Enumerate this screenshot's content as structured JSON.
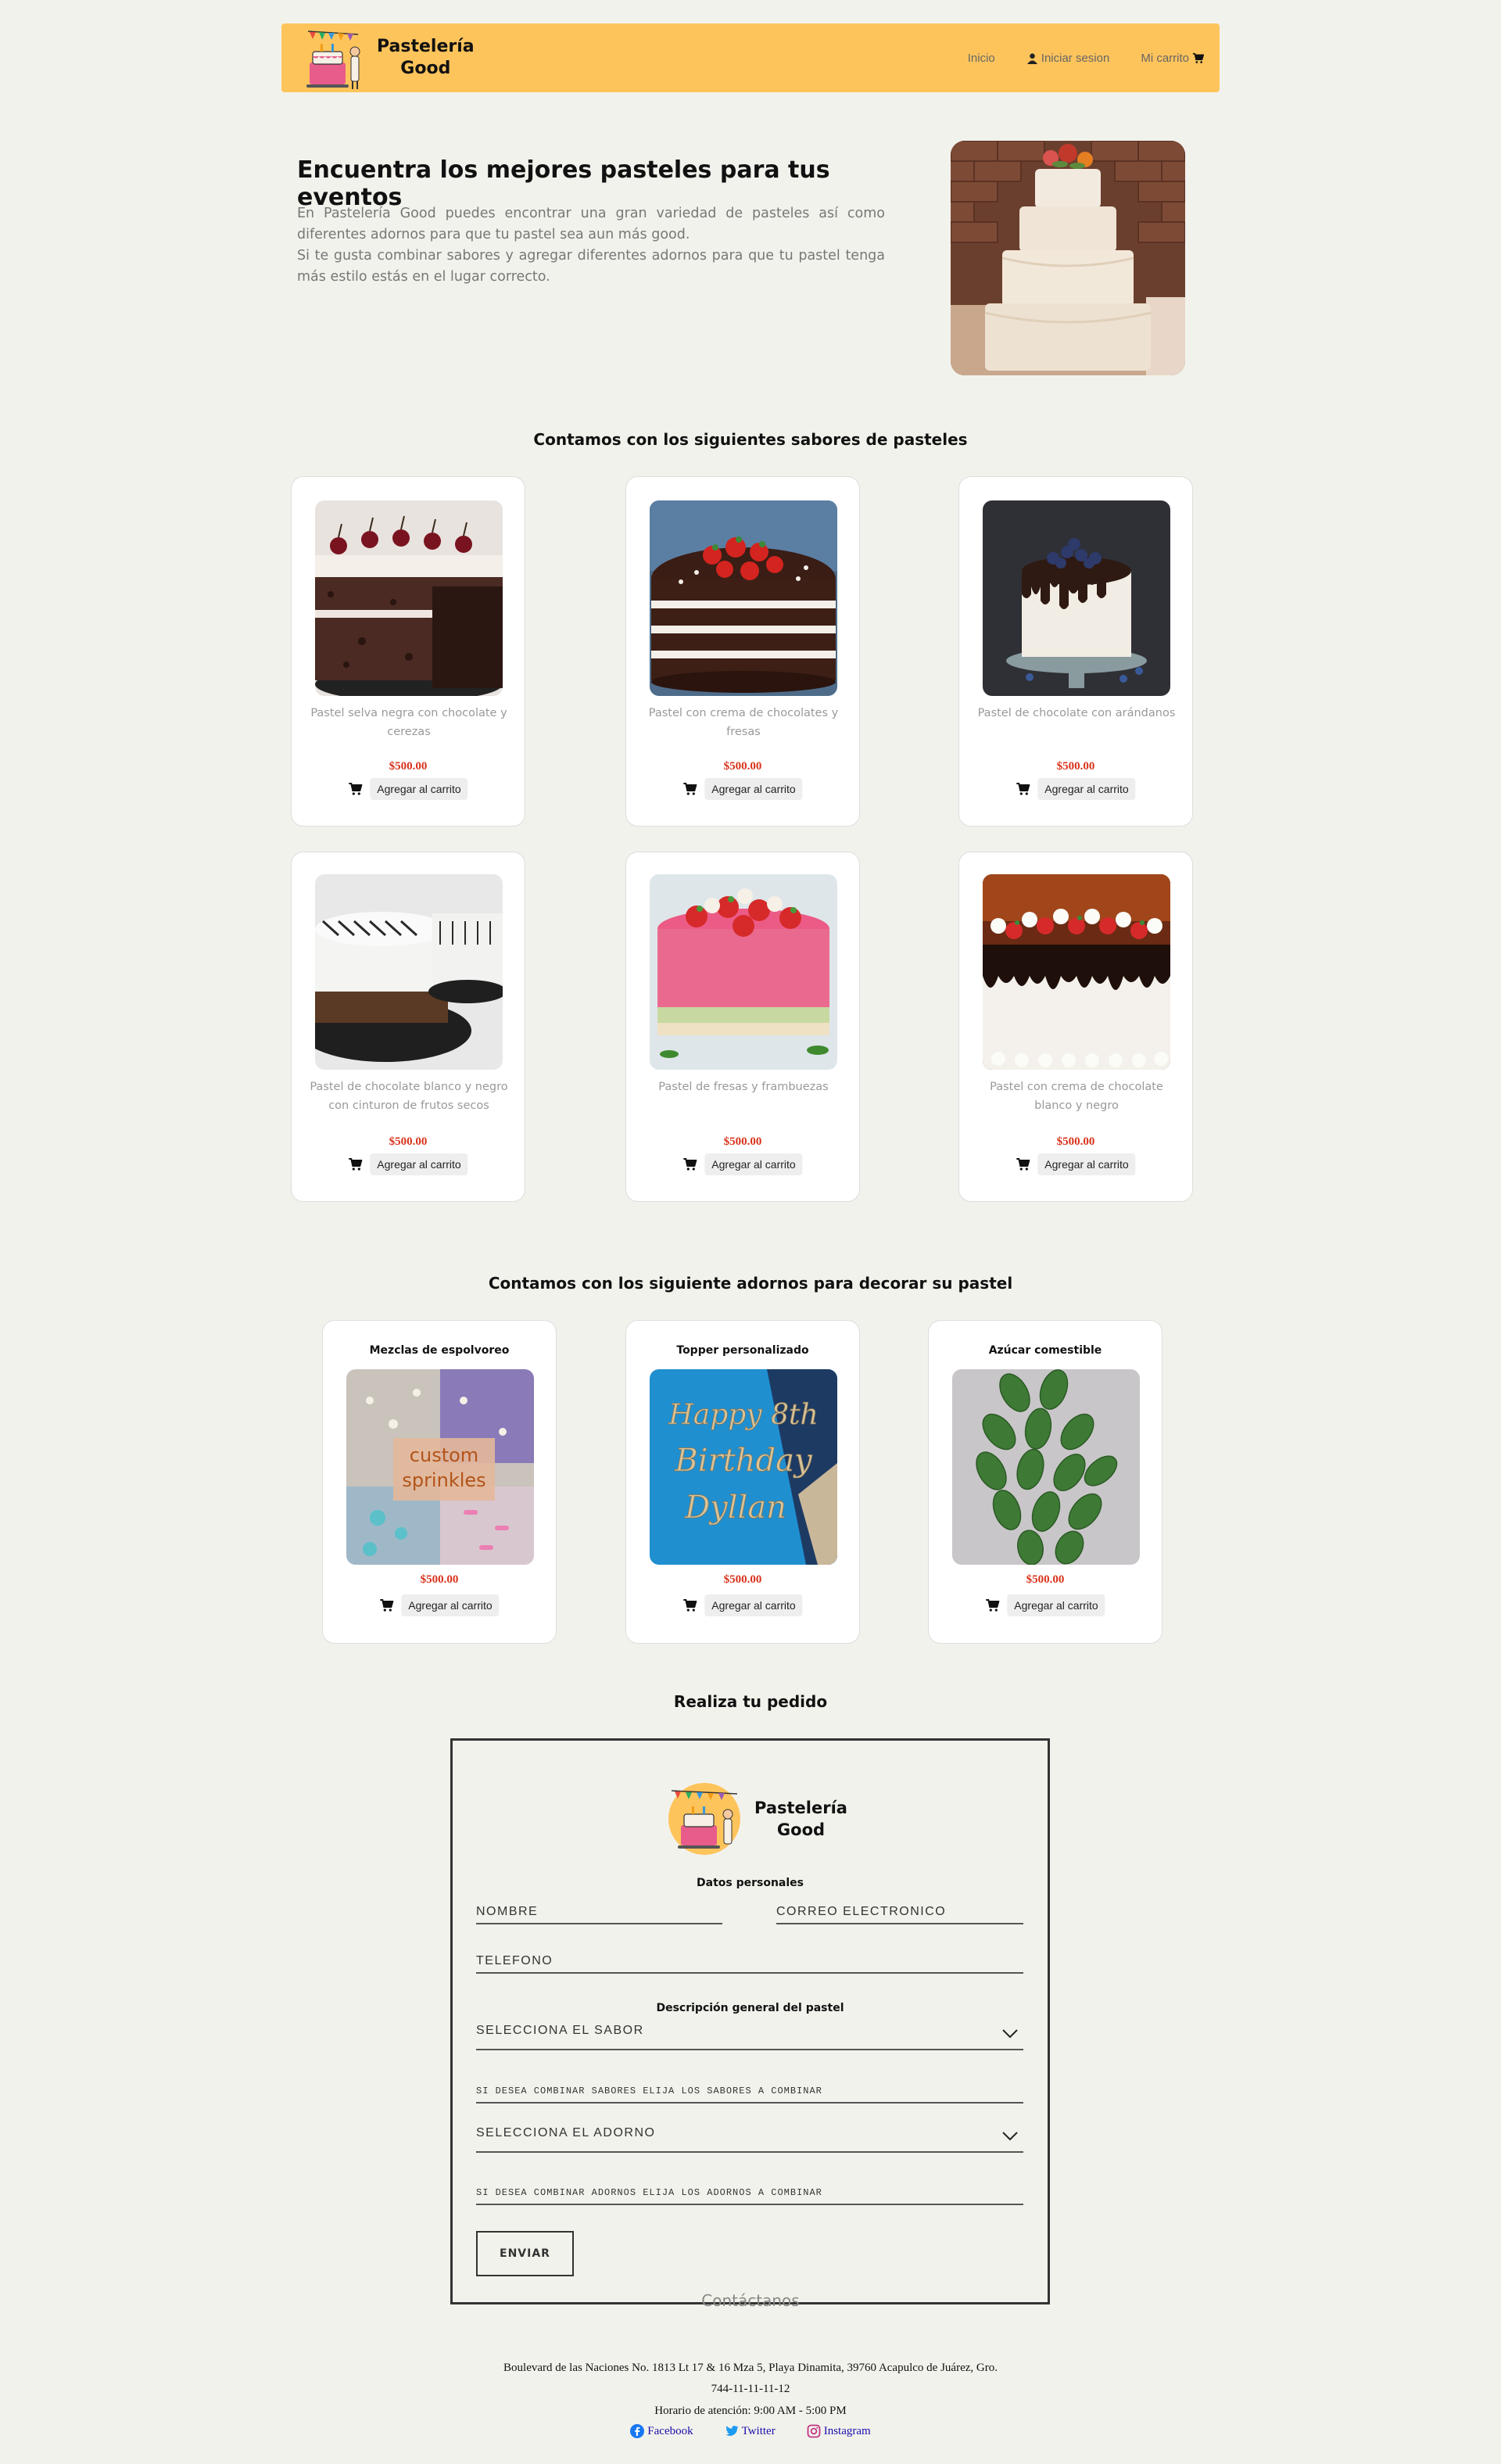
{
  "header": {
    "brand_line1": "Pastelería",
    "brand_line2": "Good",
    "nav": {
      "home": "Inicio",
      "login": "Iniciar sesion",
      "cart": "Mi carrito"
    },
    "accent": "#fec45c"
  },
  "hero": {
    "title": "Encuentra los mejores pasteles para tus eventos",
    "paragraph1": "En Pastelería Good puedes encontrar una gran variedad de pasteles así como diferentes adornos para que tu pastel sea aun más good.",
    "paragraph2": "Si te gusta combinar sabores y agregar diferentes adornos para que tu pastel tenga más estilo estás en el lugar correcto."
  },
  "flavors": {
    "title": "Contamos con los siguientes sabores de pasteles",
    "items": [
      {
        "name": "Pastel selva negra con chocolate y cerezas",
        "price": "$500.00",
        "button": "Agregar al carrito"
      },
      {
        "name": "Pastel con crema de chocolates y fresas",
        "price": "$500.00",
        "button": "Agregar al carrito"
      },
      {
        "name": "Pastel de chocolate con arándanos",
        "price": "$500.00",
        "button": "Agregar al carrito"
      },
      {
        "name": "Pastel de chocolate blanco y negro con cinturon de frutos secos",
        "price": "$500.00",
        "button": "Agregar al carrito"
      },
      {
        "name": "Pastel de fresas y frambuezas",
        "price": "$500.00",
        "button": "Agregar al carrito"
      },
      {
        "name": "Pastel con crema de chocolate blanco y negro",
        "price": "$500.00",
        "button": "Agregar al carrito"
      }
    ]
  },
  "decorations": {
    "title": "Contamos con los siguiente adornos para decorar su pastel",
    "items": [
      {
        "name": "Mezclas de espolvoreo",
        "image_text_1": "custom",
        "image_text_2": "sprinkles",
        "price": "$500.00",
        "button": "Agregar al carrito"
      },
      {
        "name": "Topper personalizado",
        "image_text_1": "Happy 8th",
        "image_text_2": "Birthday",
        "image_text_3": "Dyllan",
        "price": "$500.00",
        "button": "Agregar al carrito"
      },
      {
        "name": "Azúcar comestible",
        "price": "$500.00",
        "button": "Agregar al carrito"
      }
    ]
  },
  "order": {
    "title": "Realiza tu pedido",
    "brand_line1": "Pastelería",
    "brand_line2": "Good",
    "personal_heading": "Datos personales",
    "name_placeholder": "NOMBRE",
    "email_placeholder": "CORREO ELECTRONICO",
    "phone_placeholder": "TELEFONO",
    "cake_heading": "Descripción general del pastel",
    "flavor_select": "SELECCIONA EL SABOR",
    "flavor_combo_placeholder": "SI DESEA COMBINAR SABORES ELIJA LOS SABORES A COMBINAR",
    "decoration_select": "SELECCIONA EL ADORNO",
    "decoration_combo_placeholder": "SI DESEA COMBINAR ADORNOS ELIJA LOS ADORNOS A COMBINAR",
    "submit": "ENVIAR"
  },
  "footer": {
    "title": "Contáctanos",
    "address": "Boulevard de las Naciones No. 1813 Lt 17 & 16 Mza 5, Playa Dinamita, 39760 Acapulco de Juárez, Gro.",
    "phone": "744-11-11-11-12",
    "hours": "Horario de atención: 9:00 AM - 5:00 PM",
    "socials": {
      "facebook": "Facebook",
      "twitter": "Twitter",
      "instagram": "Instagram"
    }
  }
}
